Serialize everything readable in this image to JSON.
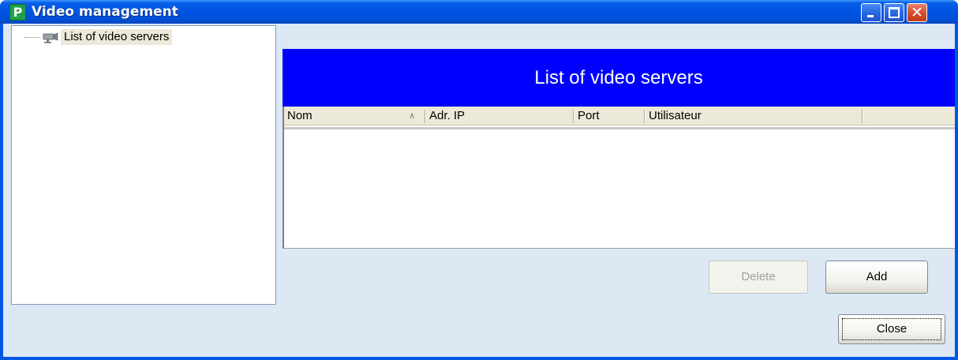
{
  "window": {
    "title": "Video management",
    "app_icon_letter": "P",
    "icon_names": [
      "app-icon",
      "minimize-icon",
      "maximize-icon",
      "close-icon"
    ]
  },
  "tree": {
    "items": [
      {
        "label": "List of video servers",
        "icon": "camera-icon"
      }
    ]
  },
  "main": {
    "header_title": "List of video servers",
    "header_color": "#0000ff",
    "columns": [
      "Nom",
      "Adr. IP",
      "Port",
      "Utilisateur"
    ],
    "sort_indicator": "∕̲",
    "rows": [],
    "buttons": {
      "delete_label": "Delete",
      "add_label": "Add"
    }
  },
  "footer": {
    "close_label": "Close"
  }
}
